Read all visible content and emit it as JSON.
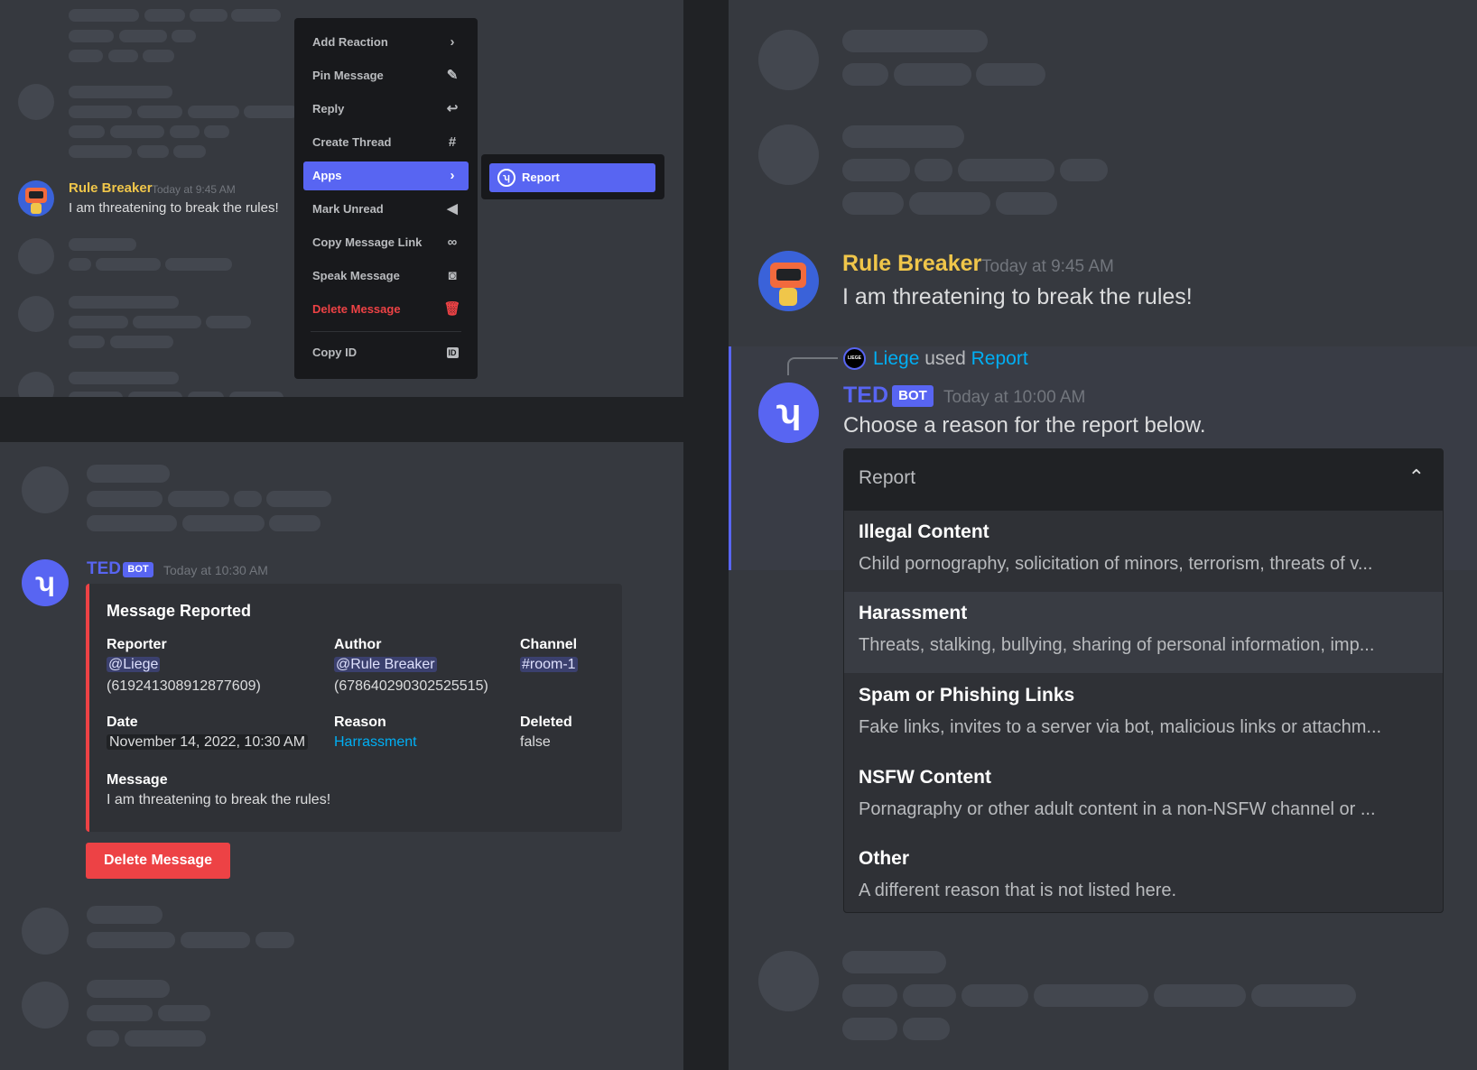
{
  "context_menu": {
    "items": [
      {
        "label": "Add Reaction",
        "icon": "›"
      },
      {
        "label": "Pin Message",
        "icon": "✎"
      },
      {
        "label": "Reply",
        "icon": "↩"
      },
      {
        "label": "Create Thread",
        "icon": "#"
      },
      {
        "label": "Apps",
        "icon": "›"
      },
      {
        "label": "Mark Unread",
        "icon": "◀"
      },
      {
        "label": "Copy Message Link",
        "icon": "∞"
      },
      {
        "label": "Speak Message",
        "icon": "◙"
      },
      {
        "label": "Delete Message",
        "icon": "🗑"
      }
    ],
    "copy_id": {
      "label": "Copy ID",
      "icon": "ID"
    },
    "submenu_label": "Report"
  },
  "original_message": {
    "author": "Rule Breaker",
    "timestamp": "Today at 9:45 AM",
    "text": "I am threatening to break the rules!"
  },
  "report_message": {
    "author": "TED",
    "bot_tag": "BOT",
    "timestamp": "Today at 10:30 AM",
    "embed": {
      "title": "Message Reported",
      "reporter_label": "Reporter",
      "reporter": "@Liege",
      "reporter_id": "(619241308912877609)",
      "author_label": "Author",
      "author": "@Rule Breaker",
      "author_id": "(678640290302525515)",
      "channel_label": "Channel",
      "channel": "#room-1",
      "date_label": "Date",
      "date": "November 14, 2022, 10:30 AM",
      "reason_label": "Reason",
      "reason": "Harrassment",
      "deleted_label": "Deleted",
      "deleted": "false",
      "message_label": "Message",
      "message": "I am threatening to break the rules!"
    },
    "delete_button": "Delete Message"
  },
  "interaction": {
    "user": "Liege",
    "used": "used",
    "command": "Report",
    "avatar_text": "LIEGE"
  },
  "bot_message": {
    "author": "TED",
    "bot_tag": "BOT",
    "timestamp": "Today at 10:00 AM",
    "text": "Choose a reason for the report below."
  },
  "select_menu": {
    "placeholder": "Report",
    "options": [
      {
        "title": "Illegal Content",
        "desc": "Child pornography, solicitation of minors, terrorism, threats of v..."
      },
      {
        "title": "Harassment",
        "desc": "Threats, stalking, bullying, sharing of personal information, imp..."
      },
      {
        "title": "Spam or Phishing Links",
        "desc": "Fake links, invites to a server via bot, malicious links or attachm..."
      },
      {
        "title": "NSFW Content",
        "desc": "Pornagraphy or other adult content in a non-NSFW channel or ..."
      },
      {
        "title": "Other",
        "desc": "A different reason that is not listed here."
      }
    ]
  },
  "colors": {
    "background": "#36393f",
    "blurple": "#5865f2",
    "danger": "#ed4245",
    "username_yellow": "#f0c64a",
    "link": "#00aff4"
  }
}
